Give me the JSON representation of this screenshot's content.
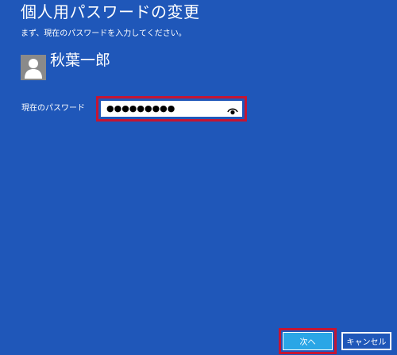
{
  "page": {
    "title": "個人用パスワードの変更",
    "subtitle": "まず、現在のパスワードを入力してください。"
  },
  "user": {
    "name": "秋葉一郎",
    "avatar_icon": "user-silhouette-icon"
  },
  "form": {
    "current_password_label": "現在のパスワード",
    "current_password_value": "●●●●●●●●●",
    "reveal_icon": "eye-icon"
  },
  "buttons": {
    "next_label": "次へ",
    "cancel_label": "キャンセル"
  },
  "colors": {
    "background": "#1f57b9",
    "highlight_border": "#c51533",
    "primary_button": "#2aa6e6",
    "avatar_bg": "#8a8a8a"
  }
}
